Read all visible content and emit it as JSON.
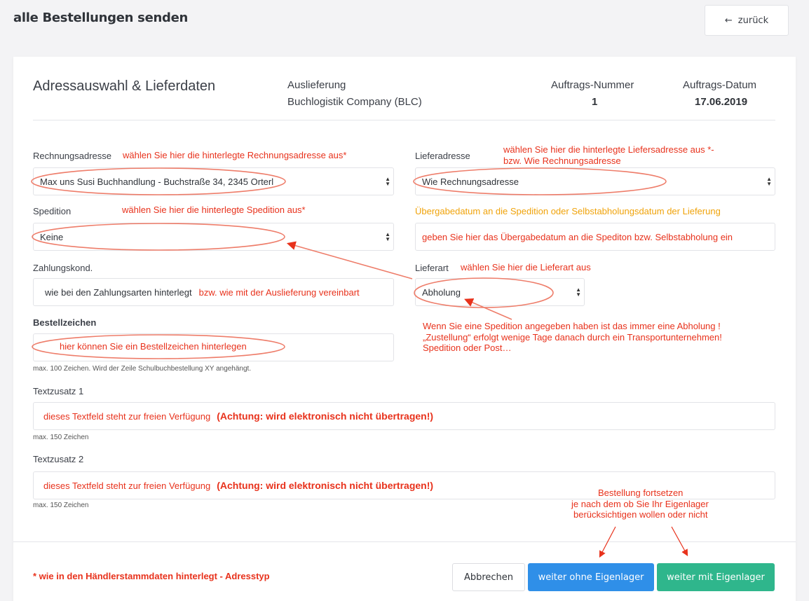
{
  "page": {
    "title": "alle Bestellungen senden",
    "back_label": "zurück",
    "back_arrow": "←"
  },
  "header": {
    "title": "Adressauswahl & Lieferdaten",
    "delivery_label": "Auslieferung",
    "delivery_value": "Buchlogistik Company (BLC)",
    "order_number_label": "Auftrags-Nummer",
    "order_number_value": "1",
    "order_date_label": "Auftrags-Datum",
    "order_date_value": "17.06.2019"
  },
  "form": {
    "billing_label": "Rechnungsadresse",
    "billing_value": "Max uns Susi Buchhandlung - Buchstraße 34, 2345 Orterl",
    "shipping_label": "Lieferadresse",
    "shipping_value": "Wie Rechnungsadresse",
    "carrier_label": "Spedition",
    "carrier_value": "Keine",
    "payment_label": "Zahlungskond.",
    "payment_value": "wie bei den Zahlungsarten hinterlegt",
    "delivery_type_label": "Lieferart",
    "delivery_type_value": "Abholung",
    "order_ref_label": "Bestellzeichen",
    "order_ref_hint": "max. 100 Zeichen. Wird der Zeile Schulbuchbestellung XY angehängt.",
    "text1_label": "Textzusatz 1",
    "text1_hint": "max. 150 Zeichen",
    "text2_label": "Textzusatz 2",
    "text2_hint": "max. 150 Zeichen"
  },
  "annotations": {
    "billing": "wählen Sie hier die hinterlegte Rechnungsadresse aus*",
    "shipping_line1": "wählen Sie hier die hinterlegte Liefersadresse aus *-",
    "shipping_line2": "bzw. Wie Rechnungsadresse",
    "carrier": "wählen Sie hier die hinterlegte Spedition aus*",
    "handover_label": "Übergabedatum an die Spedition oder Selbstabholungsdatum der Lieferung",
    "handover_input": "geben Sie hier das Übergabedatum an die Spediton bzw. Selbstabholung ein",
    "payment_extra": "bzw. wie mit der Auslieferung vereinbart",
    "delivery_type": "wählen Sie hier die Lieferart aus",
    "delivery_note_1": "Wenn Sie eine Spedition angegeben haben ist das immer eine Abholung !",
    "delivery_note_2": "„Zustellung“ erfolgt wenige Tage danach durch ein Transportunternehmen!",
    "delivery_note_3": "Spedition oder Post…",
    "order_ref": "hier können Sie ein Bestellzeichen hinterlegen",
    "text_free": "dieses Textfeld steht zur freien Verfügung",
    "text_warning": "(Achtung: wird elektronisch nicht übertragen!)",
    "text2_free": "dieses Textfeld steht zur freien Verfügung",
    "text2_warning": "(Achtung: wird elektronisch nicht übertragen!)",
    "continue_1": "Bestellung fortsetzen",
    "continue_2": "je nach dem ob Sie Ihr Eigenlager",
    "continue_3": "berücksichtigen wollen oder nicht",
    "footnote": "* wie in den Händlerstammdaten hinterlegt - Adresstyp"
  },
  "buttons": {
    "cancel": "Abbrechen",
    "without_stock": "weiter ohne Eigenlager",
    "with_stock": "weiter mit Eigenlager"
  },
  "colors": {
    "annotation_red": "#e8321c",
    "annotation_orange": "#f0a30a",
    "btn_blue": "#2f8fe8",
    "btn_green": "#2fb68c"
  }
}
